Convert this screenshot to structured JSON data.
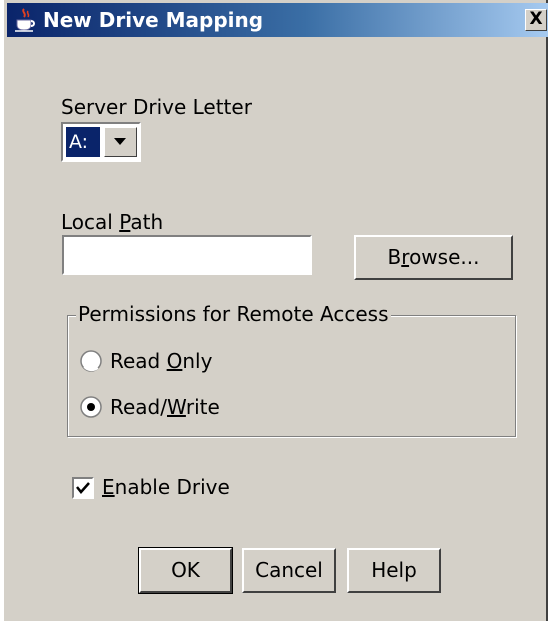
{
  "window": {
    "title": "New Drive Mapping",
    "close_glyph": "X",
    "icon": "java-cup-icon"
  },
  "server_drive": {
    "label": "Server Drive Letter",
    "selected": "A:"
  },
  "local_path": {
    "label_pre": "Local ",
    "label_mnemonic": "P",
    "label_post": "ath",
    "value": "",
    "browse_pre": "B",
    "browse_mnemonic": "r",
    "browse_post": "owse..."
  },
  "permissions": {
    "group_title": "Permissions for Remote Access",
    "options": [
      {
        "pre": "Read ",
        "mnemonic": "O",
        "post": "nly",
        "selected": false
      },
      {
        "pre": "Read/",
        "mnemonic": "W",
        "post": "rite",
        "selected": true
      }
    ]
  },
  "enable_drive": {
    "mnemonic": "E",
    "label_post": "nable Drive",
    "checked": true
  },
  "buttons": {
    "ok": "OK",
    "cancel": "Cancel",
    "help": "Help"
  },
  "colors": {
    "face": "#d4d0c8",
    "title_start": "#0a246a",
    "title_end": "#a6caf0",
    "selection": "#0a246a"
  }
}
